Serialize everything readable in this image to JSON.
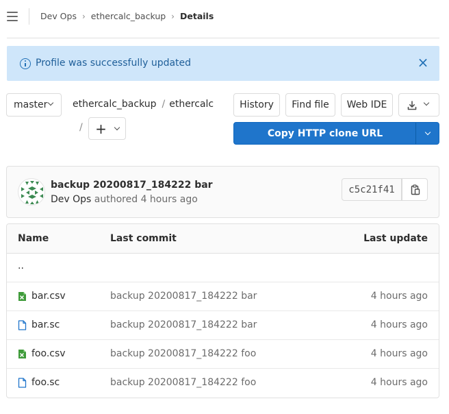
{
  "breadcrumb": {
    "items": [
      "Dev Ops",
      "ethercalc_backup"
    ],
    "current": "Details"
  },
  "flash": {
    "message": "Profile was successfully updated"
  },
  "repo": {
    "branch": "master",
    "path": [
      "ethercalc_backup",
      "ethercalc"
    ],
    "add_label": "+",
    "buttons": {
      "history": "History",
      "find_file": "Find file",
      "web_ide": "Web IDE"
    },
    "clone_label": "Copy HTTP clone URL"
  },
  "commit": {
    "title": "backup 20200817_184222 bar",
    "author": "Dev Ops",
    "verb": "authored",
    "time": "4 hours ago",
    "sha": "c5c21f41"
  },
  "table": {
    "headers": {
      "name": "Name",
      "last_commit": "Last commit",
      "last_update": "Last update"
    },
    "parent": "..",
    "rows": [
      {
        "name": "bar.csv",
        "icon": "spreadsheet-file-icon",
        "commit": "backup 20200817_184222 bar",
        "updated": "4 hours ago"
      },
      {
        "name": "bar.sc",
        "icon": "file-icon",
        "commit": "backup 20200817_184222 bar",
        "updated": "4 hours ago"
      },
      {
        "name": "foo.csv",
        "icon": "spreadsheet-file-icon",
        "commit": "backup 20200817_184222 foo",
        "updated": "4 hours ago"
      },
      {
        "name": "foo.sc",
        "icon": "file-icon",
        "commit": "backup 20200817_184222 foo",
        "updated": "4 hours ago"
      }
    ]
  },
  "colors": {
    "primary": "#1f75cb",
    "flash_bg": "#cfe6fa",
    "csv_icon": "#3f9b3a",
    "file_icon": "#1f75cb",
    "avatar": "#3c8a52"
  }
}
